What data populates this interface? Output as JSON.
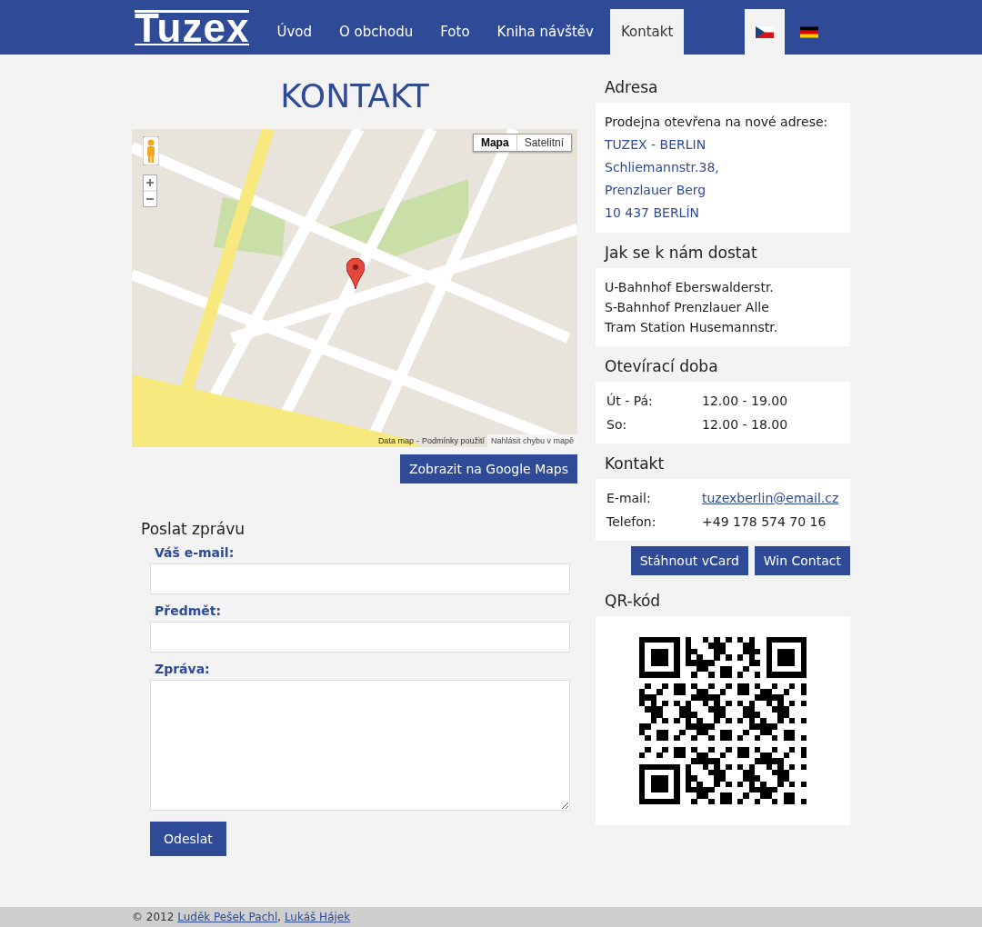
{
  "header": {
    "logo": "Tuzex",
    "nav": [
      {
        "label": "Úvod",
        "selected": false
      },
      {
        "label": "O obchodu",
        "selected": false
      },
      {
        "label": "Foto",
        "selected": false
      },
      {
        "label": "Kniha návštěv",
        "selected": false
      },
      {
        "label": "Kontakt",
        "selected": true
      }
    ],
    "languages": [
      {
        "kind": "cz",
        "selected": true
      },
      {
        "kind": "de",
        "selected": false
      }
    ]
  },
  "page_title": "KONTAKT",
  "map": {
    "map_types": [
      {
        "label": "Mapa",
        "selected": true
      },
      {
        "label": "Satelitní",
        "selected": false
      }
    ],
    "attribution": {
      "data_link": "Data map",
      "separator": "-",
      "terms_link": "Podmínky použití",
      "report": "Nahlásit chybu v mapě"
    }
  },
  "map_button": "Zobrazit na Google Maps",
  "form": {
    "title": "Poslat zprávu",
    "fields": [
      {
        "label": "Váš e-mail:",
        "kind": "input"
      },
      {
        "label": "Předmět:",
        "kind": "input"
      },
      {
        "label": "Zpráva:",
        "kind": "textarea"
      }
    ],
    "submit": "Odeslat"
  },
  "sidebar": {
    "address": {
      "title": "Adresa",
      "intro": "Prodejna otevřena na nové adrese:",
      "lines": [
        "TUZEX - BERLIN",
        "Schliemannstr.38,",
        "Prenzlauer Berg",
        "10 437 BERLÍN"
      ]
    },
    "directions": {
      "title": "Jak se k nám dostat",
      "lines": [
        "U-Bahnhof Eberswalderstr.",
        "S-Bahnhof Prenzlauer Alle",
        "Tram Station Husemannstr."
      ]
    },
    "hours": {
      "title": "Otevírací doba",
      "rows": [
        {
          "day": "Út - Pá:",
          "time": "12.00 - 19.00"
        },
        {
          "day": "So:",
          "time": "12.00 - 18.00"
        }
      ]
    },
    "contact": {
      "title": "Kontakt",
      "rows": [
        {
          "label": "E-mail:",
          "value": "tuzexberlin@email.cz",
          "kind": "link"
        },
        {
          "label": "Telefon:",
          "value": "+49 178 574 70 16",
          "kind": "text"
        }
      ],
      "buttons": [
        "Stáhnout vCard",
        "Win Contact"
      ]
    },
    "qr": {
      "title": "QR-kód"
    }
  },
  "footer": {
    "copyright": "© 2012",
    "authors": [
      "Luděk Pešek Pachl",
      "Lukáš Hájek"
    ],
    "separator": ","
  }
}
